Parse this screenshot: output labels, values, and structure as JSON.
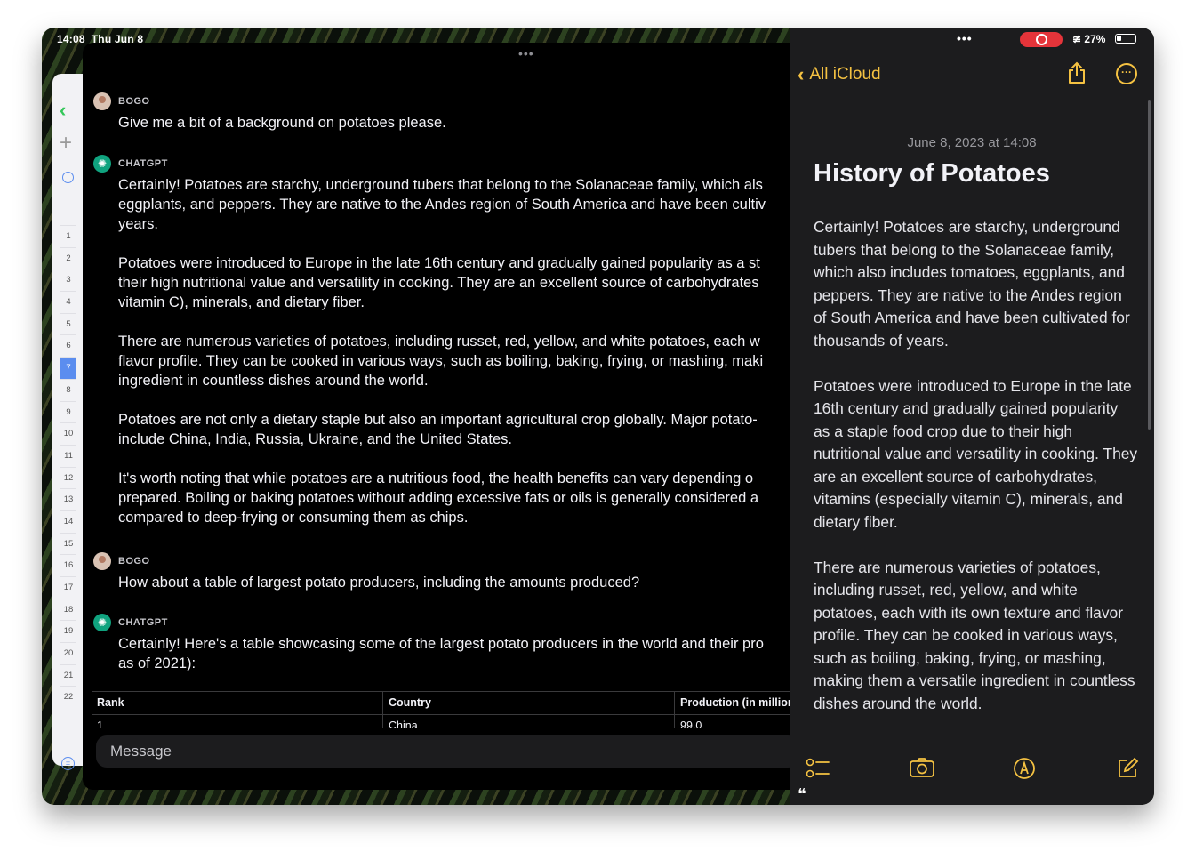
{
  "status": {
    "time": "14:08",
    "date": "Thu Jun 8",
    "battery": "27%"
  },
  "sidebar": {
    "day_numbers": [
      "1",
      "2",
      "3",
      "4",
      "5",
      "6",
      "7",
      "8",
      "9",
      "10",
      "11",
      "12",
      "13",
      "14",
      "15",
      "16",
      "17",
      "18",
      "19",
      "20",
      "21",
      "22"
    ],
    "selected": "7"
  },
  "chat": {
    "messages": [
      {
        "sender": "BOGO",
        "role": "user",
        "text": "Give me a bit of a background on potatoes please."
      },
      {
        "sender": "CHATGPT",
        "role": "assistant",
        "paragraphs": [
          [
            "Certainly! Potatoes are starchy, underground tubers that belong to the Solanaceae family, which als",
            "eggplants, and peppers. They are native to the Andes region of South America and have been cultiv",
            "years."
          ],
          [
            "Potatoes were introduced to Europe in the late 16th century and gradually gained popularity as a st",
            "their high nutritional value and versatility in cooking. They are an excellent source of carbohydrates",
            "vitamin C), minerals, and dietary fiber."
          ],
          [
            "There are numerous varieties of potatoes, including russet, red, yellow, and white potatoes, each w",
            "flavor profile. They can be cooked in various ways, such as boiling, baking, frying, or mashing, maki",
            "ingredient in countless dishes around the world."
          ],
          [
            "Potatoes are not only a dietary staple but also an important agricultural crop globally. Major potato-",
            "include China, India, Russia, Ukraine, and the United States."
          ],
          [
            "It's worth noting that while potatoes are a nutritious food, the health benefits can vary depending o",
            "prepared. Boiling or baking potatoes without adding excessive fats or oils is generally considered a",
            "compared to deep-frying or consuming them as chips."
          ]
        ]
      },
      {
        "sender": "BOGO",
        "role": "user",
        "text": "How about a table of largest potato producers, including the amounts produced?"
      },
      {
        "sender": "CHATGPT",
        "role": "assistant",
        "paragraphs": [
          [
            "Certainly! Here's a table showcasing some of the largest potato producers in the world and their pro",
            "as of 2021):"
          ]
        ]
      }
    ],
    "table": {
      "headers": [
        "Rank",
        "Country",
        "Production (in million"
      ],
      "rows": [
        [
          "1",
          "China",
          "99.0"
        ]
      ]
    },
    "input_placeholder": "Message"
  },
  "notes": {
    "back_label": "All iCloud",
    "date": "June 8, 2023 at 14:08",
    "title": "History of Potatoes",
    "paragraphs": [
      "Certainly! Potatoes are starchy, underground tubers that belong to the Solanaceae family, which also includes tomatoes, eggplants, and peppers. They are native to the Andes region of South America and have been cultivated for thousands of years.",
      "Potatoes were introduced to Europe in the late 16th century and gradually gained popularity as a staple food crop due to their high nutritional value and versatility in cooking. They are an excellent source of carbohydrates, vitamins (especially vitamin C), minerals, and dietary fiber.",
      "There are numerous varieties of potatoes, including russet, red, yellow, and white potatoes, each with its own texture and flavor profile. They can be cooked in various ways, such as boiling, baking, frying, or mashing, making them a versatile ingredient in countless dishes around the world."
    ],
    "accent_color": "#f5c242"
  }
}
